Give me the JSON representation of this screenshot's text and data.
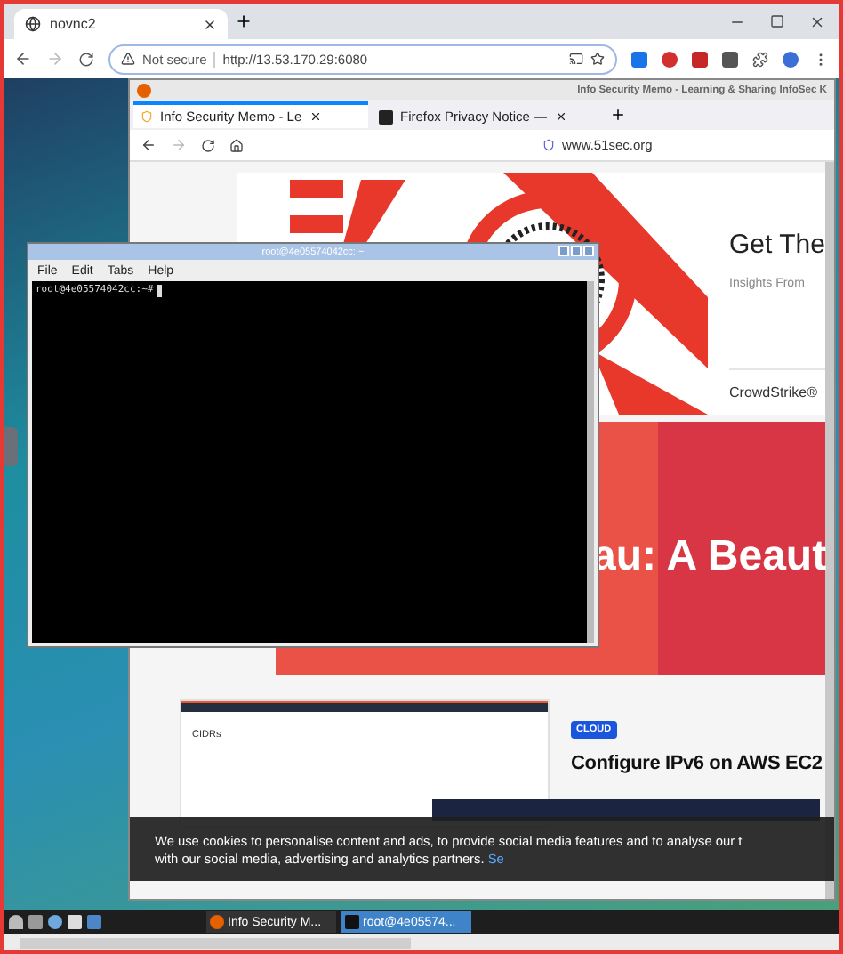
{
  "browser": {
    "tabs": [
      {
        "label": "novnc2",
        "selected": true
      }
    ],
    "address": {
      "security": "Not secure",
      "url": "http://13.53.170.29:6080"
    }
  },
  "firefox": {
    "title": "Info Security Memo - Learning & Sharing InfoSec K",
    "tabs": [
      {
        "label": "Info Security Memo - Le",
        "selected": true
      },
      {
        "label": "Firefox Privacy Notice —",
        "selected": false
      }
    ],
    "url": "www.51sec.org",
    "ad": {
      "headline": "Get The",
      "subline": "Insights From",
      "brand": "CrowdStrike®"
    },
    "banner": {
      "title": "au: A Beaut"
    },
    "post": {
      "screenshot_title": "CIDRs",
      "tag": "CLOUD",
      "title": "Configure IPv6 on AWS EC2"
    },
    "cookie": {
      "line_1": "We use cookies to personalise content and ads, to provide social media features and to analyse our t",
      "line_2": "with our social media, advertising and analytics partners.",
      "link": "Se"
    }
  },
  "terminal": {
    "title": "root@4e05574042cc: ~",
    "menu": [
      "File",
      "Edit",
      "Tabs",
      "Help"
    ],
    "prompt": "root@4e05574042cc:~#"
  },
  "taskbar": {
    "tasks": [
      {
        "label": "Info Security M...",
        "kind": "firefox",
        "selected": false
      },
      {
        "label": "root@4e05574...",
        "kind": "terminal",
        "selected": true
      }
    ]
  }
}
